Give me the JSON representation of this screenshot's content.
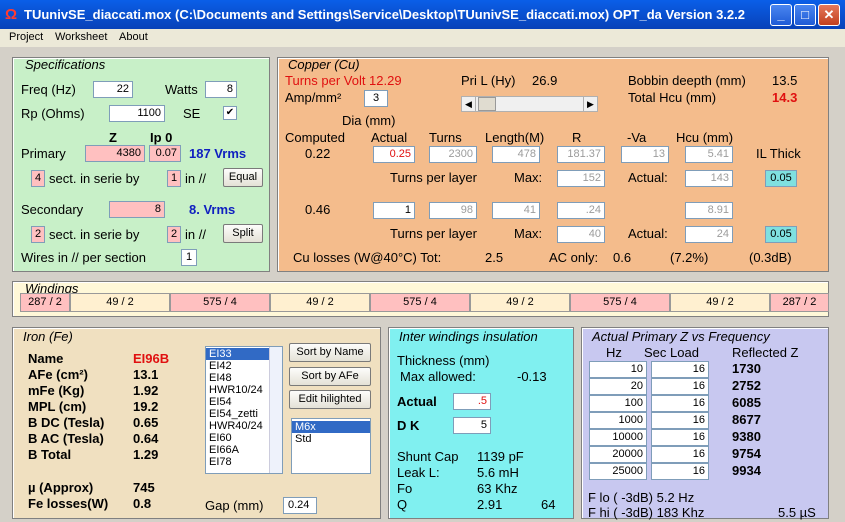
{
  "window": {
    "title": "TUunivSE_diaccati.mox  (C:\\Documents and Settings\\Service\\Desktop\\TUunivSE_diaccati.mox)  OPT_da Version 3.2.2",
    "icon": "omega-icon"
  },
  "menu": [
    "Project",
    "Worksheet",
    "About"
  ],
  "spec": {
    "title": "Specifications",
    "freq_label": "Freq (Hz)",
    "freq": "22",
    "watts_label": "Watts",
    "watts": "8",
    "rp_label": "Rp (Ohms)",
    "rp": "1100",
    "se_label": "SE",
    "z_header": "Z",
    "ip0_header": "Ip 0",
    "primary_label": "Primary",
    "primary_z": "4380",
    "primary_ip0": "0.07",
    "primary_vrms": "187 Vrms",
    "sect1": "4",
    "sect_label": "sect. in serie by",
    "par1": "1",
    "in_par": "in //",
    "equal_btn": "Equal",
    "secondary_label": "Secondary",
    "secondary_z": "8",
    "secondary_vrms": "8. Vrms",
    "sect2": "2",
    "par2": "2",
    "split_btn": "Split",
    "wires_label": "Wires in // per section",
    "wires": "1"
  },
  "copper": {
    "title": "Copper (Cu)",
    "tpv_label": "Turns per Volt 12.29",
    "pril_label": "Pri L (Hy)",
    "pril": "26.9",
    "bobbin_label": "Bobbin deepth (mm)",
    "bobbin": "13.5",
    "amp_label": "Amp/mm²",
    "amp": "3",
    "total_hcu_label": "Total Hcu (mm)",
    "total_hcu": "14.3",
    "dia_label": "Dia (mm)",
    "computed_label": "Computed",
    "actual_label": "Actual",
    "turns_label": "Turns",
    "length_label": "Length(M)",
    "r_label": "R",
    "va_label": "-Va",
    "hcu_label": "Hcu (mm)",
    "ilthick_label": "IL Thick",
    "p_computed": "0.22",
    "p_actual": "0.25",
    "p_turns": "2300",
    "p_length": "478",
    "p_r": "181.37",
    "p_va": "13",
    "p_hcu": "5.41",
    "tpl_label": "Turns per layer",
    "max_label": "Max:",
    "actual2_label": "Actual:",
    "p_max": "152",
    "p_actual_tpl": "143",
    "p_il": "0.05",
    "s_computed": "0.46",
    "s_actual": "1",
    "s_turns": "98",
    "s_length": "41",
    "s_r": ".24",
    "s_hcu": "8.91",
    "s_max": "40",
    "s_actual_tpl": "24",
    "s_il": "0.05",
    "culoss_label": "Cu losses (W@40°C) Tot:",
    "culoss_tot": "2.5",
    "ac_label": "AC only:",
    "ac": "0.6",
    "ac_pct": "(7.2%)",
    "ac_db": "(0.3dB)"
  },
  "windings": {
    "title": "Windings",
    "cells": [
      "287 / 2",
      "49 / 2",
      "575 / 4",
      "49 / 2",
      "575 / 4",
      "49 / 2",
      "575 / 4",
      "49 / 2",
      "287 / 2"
    ],
    "pink": "#ffc0c0",
    "cream": "#fff0d0"
  },
  "iron": {
    "title": "Iron (Fe)",
    "rows": [
      {
        "k": "Name",
        "v": "EI96B"
      },
      {
        "k": "AFe (cm²)",
        "v": "13.1"
      },
      {
        "k": "mFe (Kg)",
        "v": "1.92"
      },
      {
        "k": "MPL (cm)",
        "v": "19.2"
      },
      {
        "k": "B DC (Tesla)",
        "v": "0.65"
      },
      {
        "k": "B AC (Tesla)",
        "v": "0.64"
      },
      {
        "k": "B Total",
        "v": "1.29"
      }
    ],
    "mu_label": "µ (Approx)",
    "mu": "745",
    "fe_label": "Fe losses(W)",
    "fe": "0.8",
    "gap_label": "Gap (mm)",
    "gap": "0.24",
    "cores": [
      "EI33",
      "EI42",
      "EI48",
      "HWR10/24",
      "EI54",
      "EI54_zetti",
      "HWR40/24",
      "EI60",
      "EI66A",
      "EI78"
    ],
    "mats": [
      "M6x",
      "Std"
    ],
    "sort_name": "Sort by Name",
    "sort_afe": "Sort by AFe",
    "edit_btn": "Edit hilighted"
  },
  "insul": {
    "title": "Inter windings insulation",
    "thick_label": "Thickness (mm)",
    "maxallowed_label": "Max allowed:",
    "maxallowed": "-0.13",
    "actual_label": "Actual",
    "actual": ".5",
    "dk_label": "D K",
    "dk": "5",
    "shunt_label": "Shunt Cap",
    "shunt": "1139 pF",
    "leak_label": "Leak L:",
    "leak": "5.6 mH",
    "fo_label": "Fo",
    "fo": "63 Khz",
    "q_label": "Q",
    "q": "2.91",
    "q2": "64"
  },
  "freqz": {
    "title": "Actual Primary Z vs Frequency",
    "hz_label": "Hz",
    "load_label": "Sec Load",
    "refl_label": "Reflected Z",
    "rows": [
      {
        "hz": "10",
        "load": "16",
        "z": "1730"
      },
      {
        "hz": "20",
        "load": "16",
        "z": "2752"
      },
      {
        "hz": "100",
        "load": "16",
        "z": "6085"
      },
      {
        "hz": "1000",
        "load": "16",
        "z": "8677"
      },
      {
        "hz": "10000",
        "load": "16",
        "z": "9380"
      },
      {
        "hz": "20000",
        "load": "16",
        "z": "9754"
      },
      {
        "hz": "25000",
        "load": "16",
        "z": "9934"
      }
    ],
    "flo": "F lo ( -3dB) 5.2 Hz",
    "fhi": "F hi ( -3dB) 183 Khz",
    "rise": "5.5 µS"
  }
}
